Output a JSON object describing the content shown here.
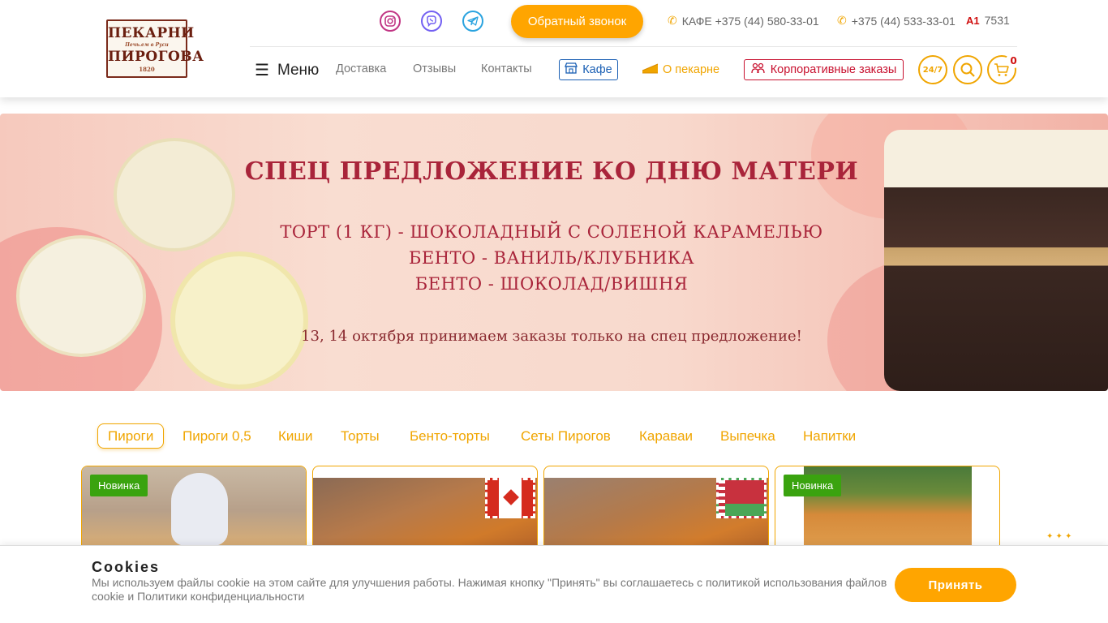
{
  "header": {
    "logo": {
      "line1": "ПЕКАРНИ",
      "line2": "ПИРОГОВА",
      "tagline": "Печь.ем  в  Руси",
      "year": "1820"
    },
    "social": [
      {
        "name": "instagram",
        "icon": "instagram-icon"
      },
      {
        "name": "viber",
        "icon": "viber-icon"
      },
      {
        "name": "telegram",
        "icon": "telegram-icon"
      }
    ],
    "callback_label": "Обратный звонок",
    "phones": [
      {
        "label": "КАФЕ +375 (44) 580-33-01",
        "icon": "phone-icon"
      },
      {
        "label": "+375 (44) 533-33-01",
        "icon": "phone-icon"
      },
      {
        "label": "7531",
        "icon": "a1-icon",
        "icon_text": "A1"
      }
    ],
    "menu_label": "Меню",
    "nav": {
      "delivery": "Доставка",
      "reviews": "Отзывы",
      "contacts": "Контакты",
      "cafe": "Кафе",
      "about": "О пекарне",
      "corporate": "Корпоративные заказы"
    },
    "icons": {
      "hours": "24/7",
      "cart_count": "0"
    }
  },
  "banner": {
    "title": "СПЕЦ ПРЕДЛОЖЕНИЕ КО ДНЮ МАТЕРИ",
    "lines": [
      "ТОРТ (1 КГ) - ШОКОЛАДНЫЙ С СОЛЕНОЙ КАРАМЕЛЬЮ",
      "БЕНТО - ВАНИЛЬ/КЛУБНИКА",
      "БЕНТО - ШОКОЛАД/ВИШНЯ"
    ],
    "note": "13, 14 октября принимаем заказы только на спец предложение!"
  },
  "tabs": [
    "Пироги",
    "Пироги 0,5",
    "Киши",
    "Торты",
    "Бенто-торты",
    "Сеты Пирогов",
    "Караваи",
    "Выпечка",
    "Напитки"
  ],
  "active_tab": "Пироги",
  "products": [
    {
      "badge": "Новинка"
    },
    {
      "flag": "canada"
    },
    {
      "flag": "belarus"
    },
    {
      "badge": "Новинка"
    }
  ],
  "cookie": {
    "title": "Cookies",
    "text": "Мы используем файлы cookie на этом сайте для улучшения работы. Нажимая кнопку \"Принять\" вы соглашаетесь с политикой использования файлов cookie и Политики конфиденциальности",
    "accept_label": "Принять"
  },
  "colors": {
    "accent": "#ffa500",
    "brand_red": "#c8102e",
    "cafe_blue": "#1a5fb4",
    "new_badge": "#3aa30f"
  }
}
